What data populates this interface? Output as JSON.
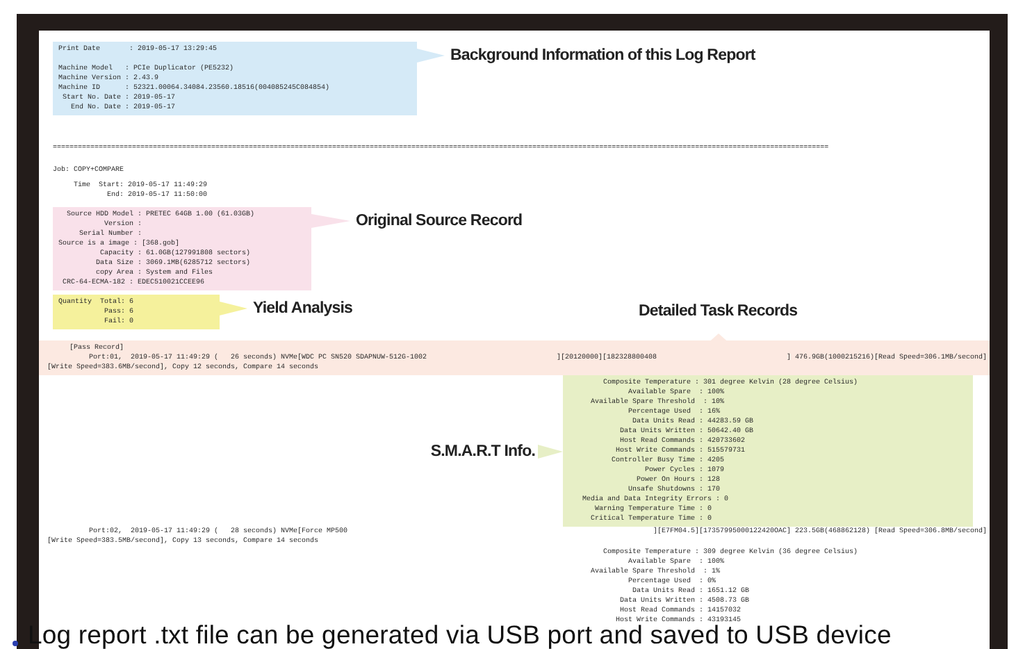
{
  "header": {
    "groups": [
      [
        "Print Date       : 2019-05-17 13:29:45"
      ],
      [
        "Machine Model   : PCIe Duplicator (PE5232)",
        "Machine Version : 2.43.9",
        "Machine ID      : 52321.00064.34084.23560.18516(004085245C084854)",
        " Start No. Date : 2019-05-17",
        "   End No. Date : 2019-05-17"
      ]
    ],
    "callout": "Background Information of this Log Report"
  },
  "separator": "==========================================================================================================================================================================================",
  "job": "Job: COPY+COMPARE",
  "time_lines": [
    "     Time  Start: 2019-05-17 11:49:29",
    "             End: 2019-05-17 11:50:00"
  ],
  "source": {
    "lines": [
      "  Source HDD Model : PRETEC 64GB 1.00 (61.03GB)",
      "           Version :",
      "     Serial Number :",
      "Source is a image : [368.gob]",
      "          Capacity : 61.0GB(127991808 sectors)",
      "         Data Size : 3069.1MB(6285712 sectors)",
      "         copy Area : System and Files",
      " CRC-64-ECMA-182 : EDEC510021CCEE96"
    ],
    "callout": "Original Source Record"
  },
  "yield": {
    "lines": [
      "Quantity  Total: 6",
      "           Pass: 6",
      "           Fail: 0"
    ],
    "callout": "Yield Analysis"
  },
  "task_callout": "Detailed Task Records",
  "records": [
    {
      "title": "[Pass Record]",
      "highlighted": true,
      "lines": [
        [
          "Port:01,  2019-05-17 11:49:29 (   26 seconds) NVMe[WDC PC SN520 SDAPNUW-512G-1002",
          "][20120000][182328800408",
          "] 476.9GB(1000215216)[Read Speed=306.1MB/second]"
        ],
        [
          "[Write Speed=383.6MB/second], Copy 12 seconds, Compare 14 seconds"
        ]
      ],
      "smart": {
        "highlighted": true,
        "callout": "S.M.A.R.T Info.",
        "lines": [
          "     Composite Temperature : 301 degree Kelvin (28 degree Celsius)",
          "           Available Spare  : 100%",
          "  Available Spare Threshold  : 10%",
          "           Percentage Used  : 16%",
          "            Data Units Read : 44283.59 GB",
          "         Data Units Written : 50642.40 GB",
          "         Host Read Commands : 420733602",
          "        Host Write Commands : 515579731",
          "       Controller Busy Time : 4205",
          "               Power Cycles : 1079",
          "             Power On Hours : 128",
          "           Unsafe Shutdowns : 170",
          "Media and Data Integrity Errors : 0",
          "   Warning Temperature Time : 0",
          "  Critical Temperature Time : 0"
        ]
      }
    },
    {
      "highlighted": false,
      "lines": [
        [
          "Port:02,  2019-05-17 11:49:29 (   28 seconds) NVMe[Force MP500",
          "][E7FM04.5][17357995000122420OAC] 223.5GB(468862128) [Read Speed=306.8MB/second]"
        ],
        [
          "[Write Speed=383.5MB/second], Copy 13 seconds, Compare 14 seconds"
        ]
      ],
      "smart": {
        "highlighted": false,
        "lines": [
          "     Composite Temperature : 309 degree Kelvin (36 degree Celsius)",
          "           Available Spare  : 100%",
          "  Available Spare Threshold  : 1%",
          "           Percentage Used  : 0%",
          "            Data Units Read : 1651.12 GB",
          "         Data Units Written : 4508.73 GB",
          "         Host Read Commands : 14157032",
          "        Host Write Commands : 43193145"
        ]
      }
    }
  ],
  "caption": "Log report .txt file can be generated via USB port and saved to USB device"
}
